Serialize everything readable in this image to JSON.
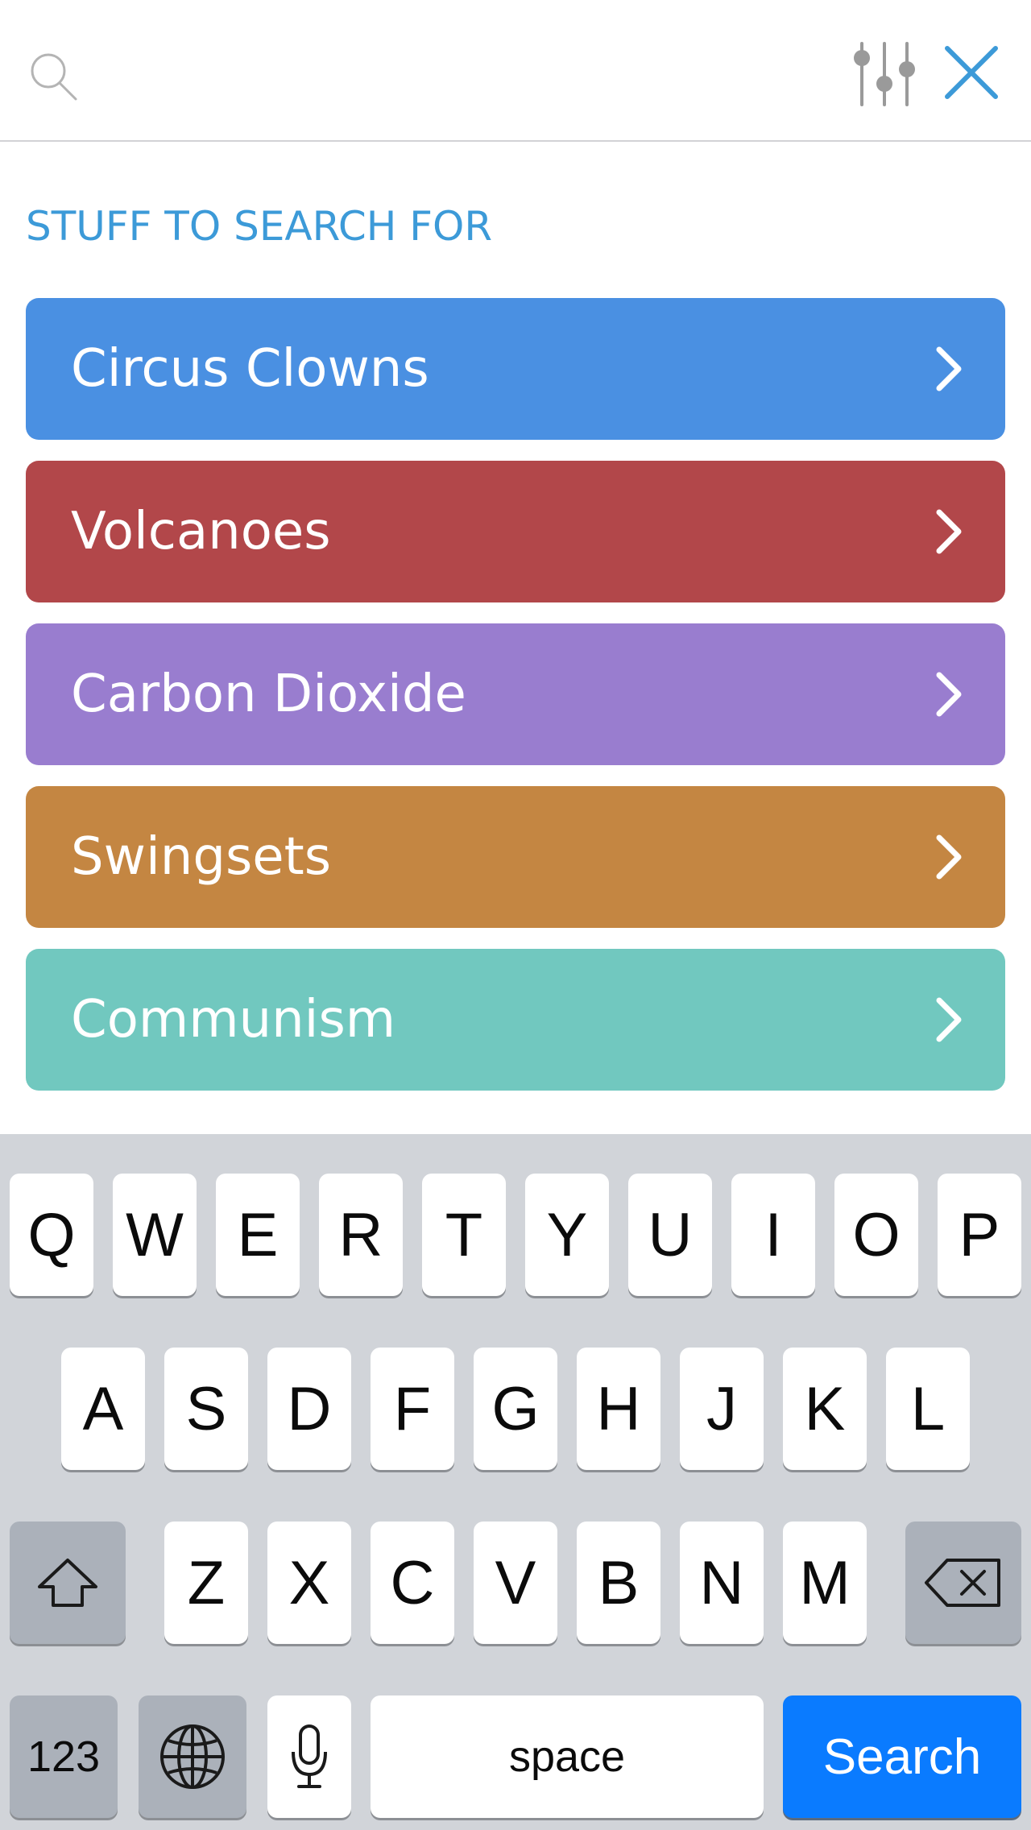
{
  "header": {
    "search_placeholder": "",
    "icons": [
      "search-icon",
      "filter-sliders-icon",
      "close-icon"
    ],
    "accent_color": "#3c9ad8"
  },
  "section": {
    "title": "STUFF TO SEARCH FOR"
  },
  "topics": [
    {
      "label": "Circus Clowns",
      "color": "#4a90e2"
    },
    {
      "label": "Volcanoes",
      "color": "#b2474a"
    },
    {
      "label": "Carbon Dioxide",
      "color": "#997dcf"
    },
    {
      "label": "Swingsets",
      "color": "#c48642"
    },
    {
      "label": "Communism",
      "color": "#71c8bf"
    }
  ],
  "keyboard": {
    "row1": [
      "Q",
      "W",
      "E",
      "R",
      "T",
      "Y",
      "U",
      "I",
      "O",
      "P"
    ],
    "row2": [
      "A",
      "S",
      "D",
      "F",
      "G",
      "H",
      "J",
      "K",
      "L"
    ],
    "row3": [
      "Z",
      "X",
      "C",
      "V",
      "B",
      "N",
      "M"
    ],
    "numbers_label": "123",
    "space_label": "space",
    "search_label": "Search",
    "icons": [
      "shift-icon",
      "backspace-icon",
      "globe-icon",
      "microphone-icon"
    ]
  }
}
